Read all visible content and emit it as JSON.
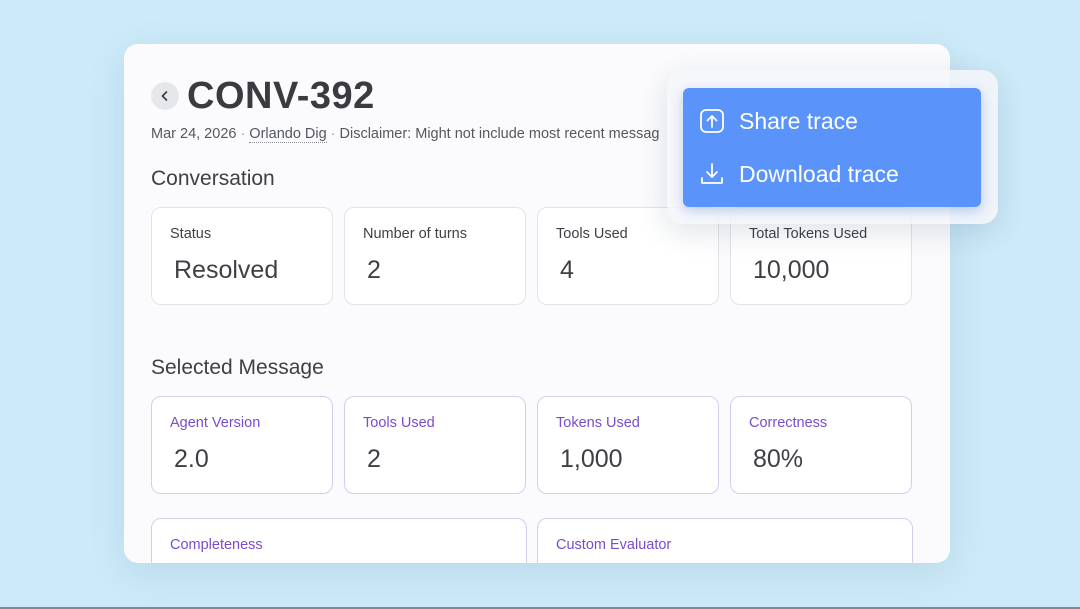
{
  "header": {
    "title": "CONV-392",
    "date": "Mar 24, 2026",
    "author": "Orlando Dig",
    "disclaimer": "Disclaimer: Might not include most recent messag"
  },
  "conversation": {
    "heading": "Conversation",
    "stats": [
      {
        "label": "Status",
        "value": "Resolved"
      },
      {
        "label": "Number of turns",
        "value": "2"
      },
      {
        "label": "Tools Used",
        "value": "4"
      },
      {
        "label": "Total Tokens Used",
        "value": "10,000"
      }
    ]
  },
  "selected_message": {
    "heading": "Selected Message",
    "stats": [
      {
        "label": "Agent Version",
        "value": "2.0"
      },
      {
        "label": "Tools Used",
        "value": "2"
      },
      {
        "label": "Tokens Used",
        "value": "1,000"
      },
      {
        "label": "Correctness",
        "value": "80%"
      }
    ],
    "evaluators": [
      {
        "label": "Completeness"
      },
      {
        "label": "Custom Evaluator"
      }
    ]
  },
  "menu": {
    "share": {
      "label": "Share trace",
      "icon": "share-icon"
    },
    "download": {
      "label": "Download trace",
      "icon": "download-icon"
    }
  },
  "colors": {
    "background": "#cdeaf8",
    "menu": "#5a94fb",
    "accent_label": "#7a4ccc"
  }
}
